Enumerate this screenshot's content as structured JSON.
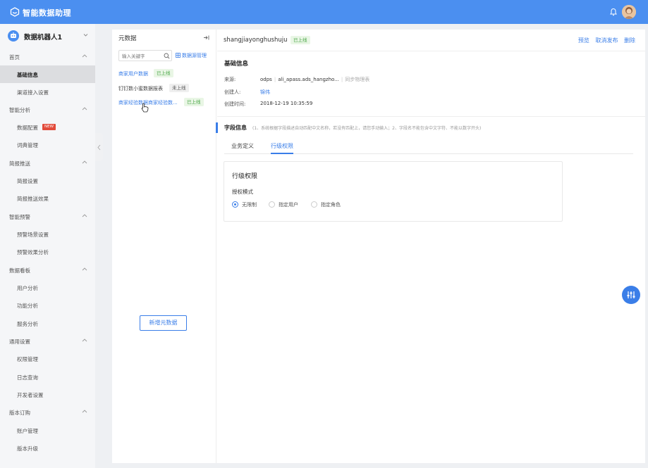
{
  "app": {
    "title": "智能数据助理"
  },
  "sidebar": {
    "bot_name": "数据机器人1",
    "groups": [
      {
        "label": "首页",
        "items": [
          {
            "label": "基础信息"
          },
          {
            "label": "渠道接入设置"
          }
        ]
      },
      {
        "label": "智能分析",
        "items": [
          {
            "label": "数据配置",
            "badge": "NEW"
          },
          {
            "label": "词典管理"
          }
        ]
      },
      {
        "label": "简报推送",
        "items": [
          {
            "label": "简报设置"
          },
          {
            "label": "简报推送效果"
          }
        ]
      },
      {
        "label": "智能预警",
        "items": [
          {
            "label": "预警场景设置"
          },
          {
            "label": "预警效果分析"
          }
        ]
      },
      {
        "label": "数据看板",
        "items": [
          {
            "label": "用户分析"
          },
          {
            "label": "功能分析"
          },
          {
            "label": "服务分析"
          }
        ]
      },
      {
        "label": "通用设置",
        "items": [
          {
            "label": "权限管理"
          },
          {
            "label": "日志查询"
          },
          {
            "label": "开发者设置"
          }
        ]
      },
      {
        "label": "版本订购",
        "items": [
          {
            "label": "账户管理"
          },
          {
            "label": "版本升级"
          }
        ]
      }
    ]
  },
  "meta_panel": {
    "title": "元数据",
    "search_placeholder": "输入关键字",
    "manage_label": "数据源管理",
    "sources": [
      {
        "name": "商家用户数据",
        "status": "已上线"
      },
      {
        "name": "钉钉数小蜜数据报表",
        "status": "未上线"
      },
      {
        "name": "商家经验数据商家经验数...",
        "status": "已上线"
      }
    ],
    "add_button": "新增元数据"
  },
  "detail": {
    "name": "shangjiayonghushuju",
    "status": "已上线",
    "actions": {
      "preview": "预览",
      "unpublish": "取消发布",
      "delete": "删除"
    },
    "basic_title": "基础信息",
    "source_label": "来源:",
    "source_type": "odps",
    "source_table": "ali_apass.ads_hangzho...",
    "sync_label": "同步物理表",
    "creator_label": "创建人:",
    "creator": "锦伟",
    "created_label": "创建时间:",
    "created_time": "2018-12-19 10:35:59",
    "field_title": "字段信息",
    "field_hint": "(1、系统根据字段描述自动匹配中文名称，若没有匹配上，请您手动输入；2、字段名不能包含中文字符、不能以数字开头)",
    "tabs": [
      "业务定义",
      "行级权限"
    ],
    "active_tab": "行级权限",
    "row_permission": {
      "title": "行级权限",
      "auth_mode_label": "授权模式",
      "options": [
        "无限制",
        "指定用户",
        "指定角色"
      ],
      "selected": "无限制"
    }
  },
  "colors": {
    "topbar": "#4b8ff0",
    "accent": "#3a7ee8",
    "online_green": "#49a646",
    "new_badge": "#e24b3b"
  }
}
